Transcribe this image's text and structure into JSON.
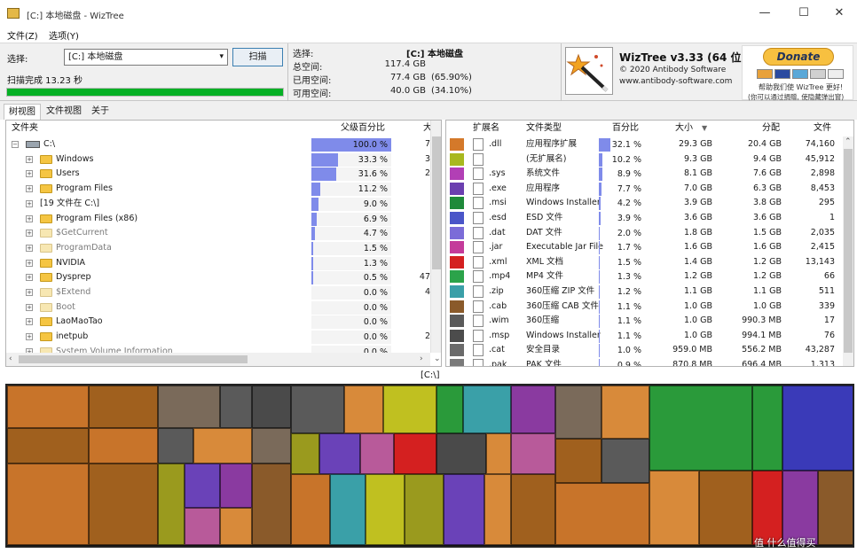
{
  "window": {
    "title": "[C:] 本地磁盘 - WizTree",
    "minimize": "—",
    "maximize": "☐",
    "close": "✕"
  },
  "menu": {
    "file": "文件(Z)",
    "options": "选项(Y)"
  },
  "scan": {
    "select_label": "选择:",
    "drive_value": "[C:] 本地磁盘",
    "scan_button": "扫描",
    "status": "扫描完成 13.23 秒",
    "progress": 1.0
  },
  "stats": {
    "select_label": "选择:",
    "select_value": "[C:]  本地磁盘",
    "total_label": "总空间:",
    "total_value": "117.4 GB",
    "used_label": "已用空间:",
    "used_value": "77.4 GB",
    "used_pct": "(65.90%)",
    "free_label": "可用空间:",
    "free_value": "40.0 GB",
    "free_pct": "(34.10%)"
  },
  "about": {
    "title": "WizTree v3.33 (64 位)",
    "copyright": "© 2020 Antibody Software",
    "url": "www.antibody-software.com",
    "donate": "Donate",
    "donate_line1": "帮助我们使 WizTree 更好!",
    "donate_line2": "(你可以通过捐赠, 使隐藏弹出窗)"
  },
  "tabs": [
    "树视图",
    "文件视图",
    "关于"
  ],
  "tree": {
    "col_folder": "文件夹",
    "col_percent": "父级百分比",
    "col_size": "大小",
    "rows": [
      {
        "name": "C:\\",
        "percent": "100.0 %",
        "pct": 1.0,
        "size": "7",
        "level": 0,
        "folder": false,
        "expander": "−"
      },
      {
        "name": "Windows",
        "percent": "33.3 %",
        "pct": 0.333,
        "size": "3",
        "level": 1,
        "folder": true,
        "faded": false,
        "expander": "+"
      },
      {
        "name": "Users",
        "percent": "31.6 %",
        "pct": 0.316,
        "size": "2",
        "level": 1,
        "folder": true,
        "faded": false,
        "expander": "+"
      },
      {
        "name": "Program Files",
        "percent": "11.2 %",
        "pct": 0.112,
        "size": "",
        "level": 1,
        "folder": true,
        "faded": false,
        "expander": "+"
      },
      {
        "name": "[19 文件在 C:\\]",
        "percent": "9.0 %",
        "pct": 0.09,
        "size": "",
        "level": 1,
        "folder": false,
        "expander": "+"
      },
      {
        "name": "Program Files (x86)",
        "percent": "6.9 %",
        "pct": 0.069,
        "size": "",
        "level": 1,
        "folder": true,
        "faded": false,
        "expander": "+"
      },
      {
        "name": "$GetCurrent",
        "percent": "4.7 %",
        "pct": 0.047,
        "size": "",
        "level": 1,
        "folder": true,
        "faded": true,
        "expander": "+"
      },
      {
        "name": "ProgramData",
        "percent": "1.5 %",
        "pct": 0.015,
        "size": "",
        "level": 1,
        "folder": true,
        "faded": true,
        "expander": "+"
      },
      {
        "name": "NVIDIA",
        "percent": "1.3 %",
        "pct": 0.013,
        "size": "",
        "level": 1,
        "folder": true,
        "faded": false,
        "expander": "+"
      },
      {
        "name": "Dysprep",
        "percent": "0.5 %",
        "pct": 0.005,
        "size": "47",
        "level": 1,
        "folder": true,
        "faded": false,
        "expander": "+"
      },
      {
        "name": "$Extend",
        "percent": "0.0 %",
        "pct": 0.0,
        "size": "4",
        "level": 1,
        "folder": true,
        "faded": true,
        "expander": "+"
      },
      {
        "name": "Boot",
        "percent": "0.0 %",
        "pct": 0.0,
        "size": "",
        "level": 1,
        "folder": true,
        "faded": true,
        "expander": "+"
      },
      {
        "name": "LaoMaoTao",
        "percent": "0.0 %",
        "pct": 0.0,
        "size": "",
        "level": 1,
        "folder": true,
        "faded": false,
        "expander": "+"
      },
      {
        "name": "inetpub",
        "percent": "0.0 %",
        "pct": 0.0,
        "size": "2",
        "level": 1,
        "folder": true,
        "faded": false,
        "expander": "+"
      },
      {
        "name": "System Volume Information",
        "percent": "0.0 %",
        "pct": 0.0,
        "size": "",
        "level": 1,
        "folder": true,
        "faded": true,
        "expander": "+"
      }
    ]
  },
  "ext": {
    "col_ext": "扩展名",
    "col_type": "文件类型",
    "col_pct": "百分比",
    "col_size": "大小",
    "col_alloc": "分配",
    "col_files": "文件",
    "rows": [
      {
        "color": "#d4792a",
        "ext": ".dll",
        "type": "应用程序扩展",
        "percent": "32.1 %",
        "pct": 0.321,
        "size": "29.3 GB",
        "alloc": "20.4 GB",
        "files": "74,160"
      },
      {
        "color": "#a8b81e",
        "ext": "",
        "type": "(无扩展名)",
        "percent": "10.2 %",
        "pct": 0.102,
        "size": "9.3 GB",
        "alloc": "9.4 GB",
        "files": "45,912"
      },
      {
        "color": "#b23fb5",
        "ext": ".sys",
        "type": "系统文件",
        "percent": "8.9 %",
        "pct": 0.089,
        "size": "8.1 GB",
        "alloc": "7.6 GB",
        "files": "2,898"
      },
      {
        "color": "#6b3fb0",
        "ext": ".exe",
        "type": "应用程序",
        "percent": "7.7 %",
        "pct": 0.077,
        "size": "7.0 GB",
        "alloc": "6.3 GB",
        "files": "8,453"
      },
      {
        "color": "#1f8a3a",
        "ext": ".msi",
        "type": "Windows Installer",
        "percent": "4.2 %",
        "pct": 0.042,
        "size": "3.9 GB",
        "alloc": "3.8 GB",
        "files": "295"
      },
      {
        "color": "#4a55c8",
        "ext": ".esd",
        "type": "ESD 文件",
        "percent": "3.9 %",
        "pct": 0.039,
        "size": "3.6 GB",
        "alloc": "3.6 GB",
        "files": "1"
      },
      {
        "color": "#7b6cd8",
        "ext": ".dat",
        "type": "DAT 文件",
        "percent": "2.0 %",
        "pct": 0.02,
        "size": "1.8 GB",
        "alloc": "1.5 GB",
        "files": "2,035"
      },
      {
        "color": "#c43b9a",
        "ext": ".jar",
        "type": "Executable Jar File",
        "percent": "1.7 %",
        "pct": 0.017,
        "size": "1.6 GB",
        "alloc": "1.6 GB",
        "files": "2,415"
      },
      {
        "color": "#d42020",
        "ext": ".xml",
        "type": "XML 文档",
        "percent": "1.5 %",
        "pct": 0.015,
        "size": "1.4 GB",
        "alloc": "1.2 GB",
        "files": "13,143"
      },
      {
        "color": "#2ba34a",
        "ext": ".mp4",
        "type": "MP4 文件",
        "percent": "1.3 %",
        "pct": 0.013,
        "size": "1.2 GB",
        "alloc": "1.2 GB",
        "files": "66"
      },
      {
        "color": "#3a9fa8",
        "ext": ".zip",
        "type": "360压缩 ZIP 文件",
        "percent": "1.2 %",
        "pct": 0.012,
        "size": "1.1 GB",
        "alloc": "1.1 GB",
        "files": "511"
      },
      {
        "color": "#8a5a2a",
        "ext": ".cab",
        "type": "360压缩 CAB 文件",
        "percent": "1.1 %",
        "pct": 0.011,
        "size": "1.0 GB",
        "alloc": "1.0 GB",
        "files": "339"
      },
      {
        "color": "#5a5a5a",
        "ext": ".wim",
        "type": "360压缩",
        "percent": "1.1 %",
        "pct": 0.011,
        "size": "1.0 GB",
        "alloc": "990.3 MB",
        "files": "17"
      },
      {
        "color": "#4c4c4c",
        "ext": ".msp",
        "type": "Windows Installer",
        "percent": "1.1 %",
        "pct": 0.011,
        "size": "1.0 GB",
        "alloc": "994.1 MB",
        "files": "76"
      },
      {
        "color": "#6a6a6a",
        "ext": ".cat",
        "type": "安全目录",
        "percent": "1.0 %",
        "pct": 0.01,
        "size": "959.0 MB",
        "alloc": "556.2 MB",
        "files": "43,287"
      },
      {
        "color": "#7a7a7a",
        "ext": ".pak",
        "type": "PAK 文件",
        "percent": "0.9 %",
        "pct": 0.009,
        "size": "870.8 MB",
        "alloc": "696.4 MB",
        "files": "1,313"
      }
    ]
  },
  "treemap": {
    "label": "[C:\\]"
  },
  "watermark": "值 什么值得买"
}
